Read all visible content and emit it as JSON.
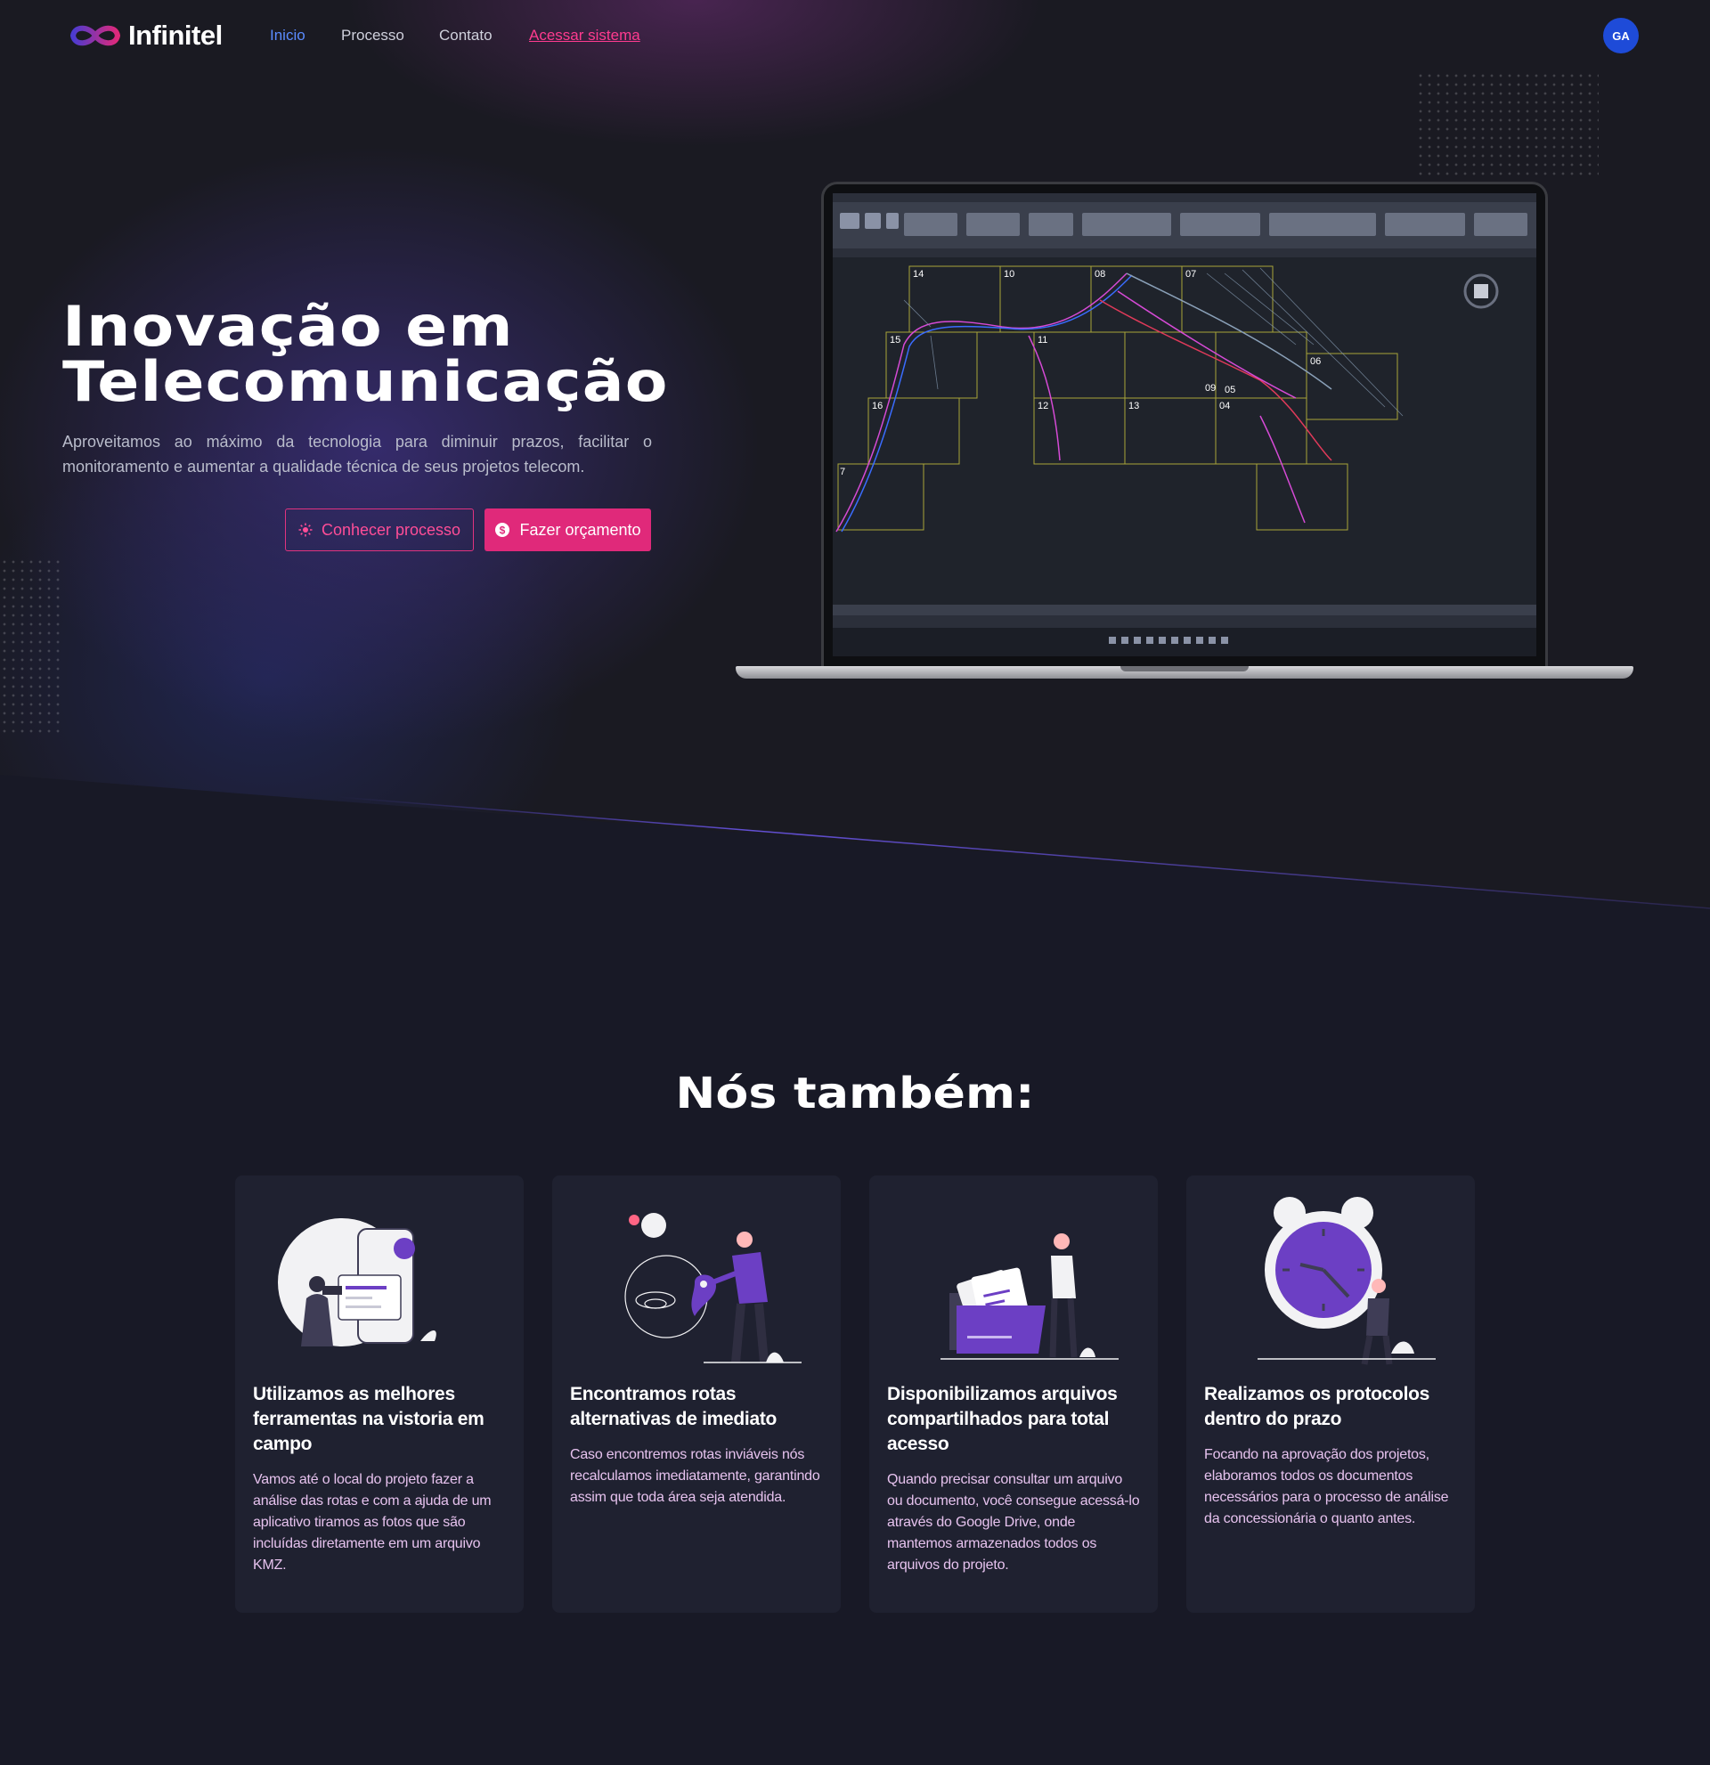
{
  "brand": {
    "name": "Infinitel",
    "colors": {
      "accent": "#e0297a",
      "nav_active": "#5b8cff",
      "avatar": "#1e4bd8",
      "card_text": "#e6c2ee"
    }
  },
  "nav": {
    "links": [
      "Inicio",
      "Processo",
      "Contato",
      "Acessar sistema"
    ],
    "avatar_initials": "GA"
  },
  "hero": {
    "title_line1": "Inovação em",
    "title_line2": "Telecomunicação",
    "subtitle": "Aproveitamos ao máximo da tecnologia para diminuir prazos, facilitar o monitoramento e aumentar a qualidade técnica de seus projetos telecom.",
    "btn_process": "Conhecer processo",
    "btn_process_icon": "lightbulb-icon",
    "btn_quote": "Fazer orçamento",
    "btn_quote_icon": "dollar-icon",
    "laptop_screen_labels": [
      "14",
      "10",
      "08",
      "07",
      "15",
      "11",
      "06",
      "16",
      "12",
      "13",
      "09",
      "05",
      "04",
      "7"
    ]
  },
  "section": {
    "title": "Nós também:",
    "cards": [
      {
        "title": "Utilizamos as melhores ferramentas na vistoria em campo",
        "text": "Vamos até o local do projeto fazer a análise das rotas e com a ajuda de um aplicativo tiramos as fotos que são incluídas diretamente em um arquivo KMZ.",
        "icon": "field-survey-illustration"
      },
      {
        "title": "Encontramos rotas alternativas de imediato",
        "text": "Caso encontremos rotas inviáveis nós recalculamos imediatamente, garantindo assim que toda área seja atendida.",
        "icon": "route-map-illustration"
      },
      {
        "title": "Disponibilizamos arquivos compartilhados para total acesso",
        "text": "Quando precisar consultar um arquivo ou documento, você consegue acessá-lo através do Google Drive, onde mantemos armazenados todos os arquivos do projeto.",
        "icon": "shared-files-illustration"
      },
      {
        "title": "Realizamos os protocolos dentro do prazo",
        "text": "Focando na aprovação dos projetos, elaboramos todos os documentos necessários para o processo de análise da concessionária o quanto antes.",
        "icon": "alarm-clock-illustration"
      }
    ]
  }
}
